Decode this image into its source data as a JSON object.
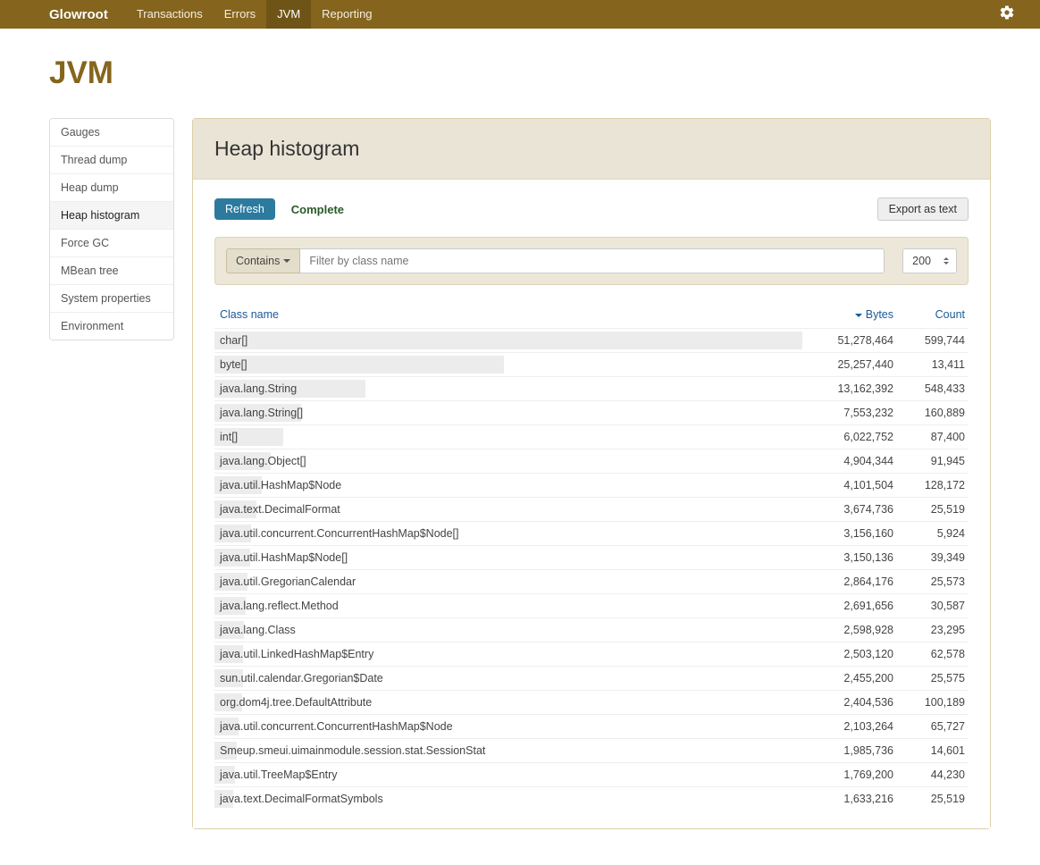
{
  "brand": "Glowroot",
  "nav": {
    "items": [
      "Transactions",
      "Errors",
      "JVM",
      "Reporting"
    ],
    "active": "JVM"
  },
  "page_title": "JVM",
  "sidebar": {
    "items": [
      "Gauges",
      "Thread dump",
      "Heap dump",
      "Heap histogram",
      "Force GC",
      "MBean tree",
      "System properties",
      "Environment"
    ],
    "active": "Heap histogram"
  },
  "panel": {
    "title": "Heap histogram",
    "refresh_label": "Refresh",
    "status": "Complete",
    "export_label": "Export as text",
    "filter_mode": "Contains",
    "filter_placeholder": "Filter by class name",
    "limit_value": "200"
  },
  "table": {
    "columns": {
      "class_name": "Class name",
      "bytes": "Bytes",
      "count": "Count"
    },
    "max_bytes": 51278464,
    "rows": [
      {
        "name": "char[]",
        "bytes": 51278464,
        "bytes_str": "51,278,464",
        "count_str": "599,744"
      },
      {
        "name": "byte[]",
        "bytes": 25257440,
        "bytes_str": "25,257,440",
        "count_str": "13,411"
      },
      {
        "name": "java.lang.String",
        "bytes": 13162392,
        "bytes_str": "13,162,392",
        "count_str": "548,433"
      },
      {
        "name": "java.lang.String[]",
        "bytes": 7553232,
        "bytes_str": "7,553,232",
        "count_str": "160,889"
      },
      {
        "name": "int[]",
        "bytes": 6022752,
        "bytes_str": "6,022,752",
        "count_str": "87,400"
      },
      {
        "name": "java.lang.Object[]",
        "bytes": 4904344,
        "bytes_str": "4,904,344",
        "count_str": "91,945"
      },
      {
        "name": "java.util.HashMap$Node",
        "bytes": 4101504,
        "bytes_str": "4,101,504",
        "count_str": "128,172"
      },
      {
        "name": "java.text.DecimalFormat",
        "bytes": 3674736,
        "bytes_str": "3,674,736",
        "count_str": "25,519"
      },
      {
        "name": "java.util.concurrent.ConcurrentHashMap$Node[]",
        "bytes": 3156160,
        "bytes_str": "3,156,160",
        "count_str": "5,924"
      },
      {
        "name": "java.util.HashMap$Node[]",
        "bytes": 3150136,
        "bytes_str": "3,150,136",
        "count_str": "39,349"
      },
      {
        "name": "java.util.GregorianCalendar",
        "bytes": 2864176,
        "bytes_str": "2,864,176",
        "count_str": "25,573"
      },
      {
        "name": "java.lang.reflect.Method",
        "bytes": 2691656,
        "bytes_str": "2,691,656",
        "count_str": "30,587"
      },
      {
        "name": "java.lang.Class",
        "bytes": 2598928,
        "bytes_str": "2,598,928",
        "count_str": "23,295"
      },
      {
        "name": "java.util.LinkedHashMap$Entry",
        "bytes": 2503120,
        "bytes_str": "2,503,120",
        "count_str": "62,578"
      },
      {
        "name": "sun.util.calendar.Gregorian$Date",
        "bytes": 2455200,
        "bytes_str": "2,455,200",
        "count_str": "25,575"
      },
      {
        "name": "org.dom4j.tree.DefaultAttribute",
        "bytes": 2404536,
        "bytes_str": "2,404,536",
        "count_str": "100,189"
      },
      {
        "name": "java.util.concurrent.ConcurrentHashMap$Node",
        "bytes": 2103264,
        "bytes_str": "2,103,264",
        "count_str": "65,727"
      },
      {
        "name": "Smeup.smeui.uimainmodule.session.stat.SessionStat",
        "bytes": 1985736,
        "bytes_str": "1,985,736",
        "count_str": "14,601"
      },
      {
        "name": "java.util.TreeMap$Entry",
        "bytes": 1769200,
        "bytes_str": "1,769,200",
        "count_str": "44,230"
      },
      {
        "name": "java.text.DecimalFormatSymbols",
        "bytes": 1633216,
        "bytes_str": "1,633,216",
        "count_str": "25,519"
      }
    ]
  }
}
